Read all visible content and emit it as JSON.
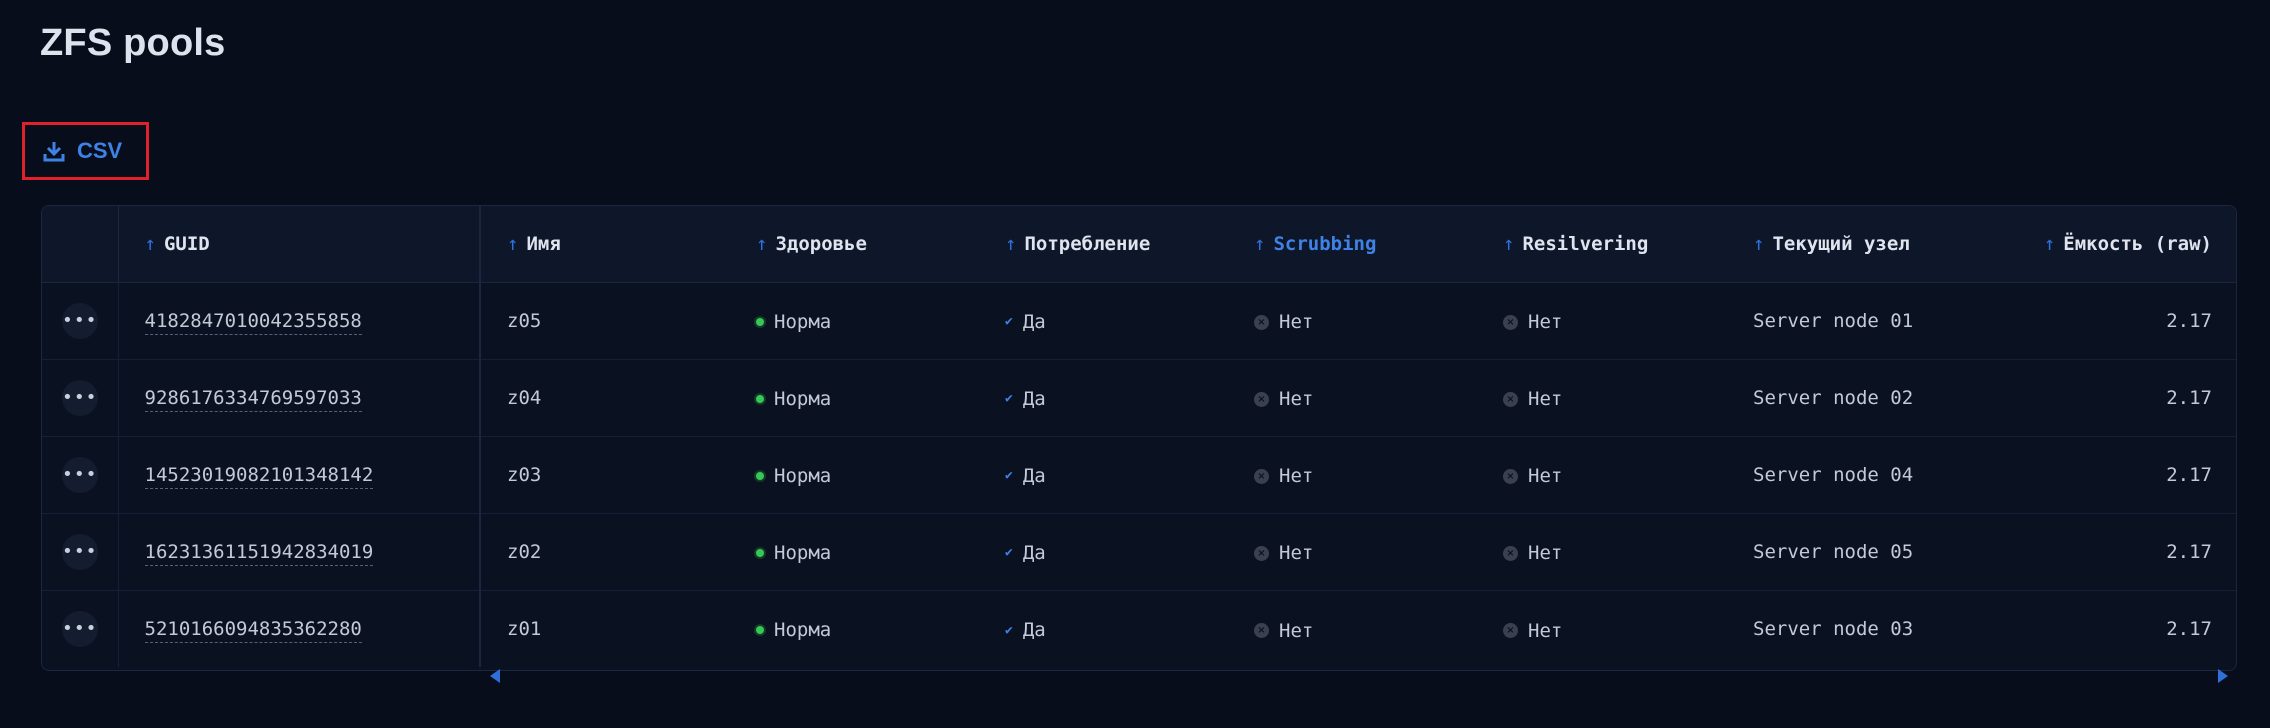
{
  "page": {
    "title": "ZFS pools"
  },
  "toolbar": {
    "csv_label": "CSV",
    "csv_icon": "download-icon",
    "accent": "#3f82e6"
  },
  "table": {
    "columns": [
      {
        "key": "guid",
        "label": "GUID"
      },
      {
        "key": "name",
        "label": "Имя"
      },
      {
        "key": "health",
        "label": "Здоровье"
      },
      {
        "key": "consumption",
        "label": "Потребление"
      },
      {
        "key": "scrubbing",
        "label": "Scrubbing",
        "active": true
      },
      {
        "key": "resilvering",
        "label": "Resilvering"
      },
      {
        "key": "node",
        "label": "Текущий узел"
      },
      {
        "key": "capacity",
        "label": "Ёмкость (raw)"
      }
    ],
    "rows": [
      {
        "guid": "4182847010042355858",
        "name": "z05",
        "health": "Норма",
        "consumption": "Да",
        "scrubbing": "Нет",
        "resilvering": "Нет",
        "node": "Server node 01",
        "capacity": "2.17"
      },
      {
        "guid": "9286176334769597033",
        "name": "z04",
        "health": "Норма",
        "consumption": "Да",
        "scrubbing": "Нет",
        "resilvering": "Нет",
        "node": "Server node 02",
        "capacity": "2.17"
      },
      {
        "guid": "14523019082101348142",
        "name": "z03",
        "health": "Норма",
        "consumption": "Да",
        "scrubbing": "Нет",
        "resilvering": "Нет",
        "node": "Server node 04",
        "capacity": "2.17"
      },
      {
        "guid": "16231361151942834019",
        "name": "z02",
        "health": "Норма",
        "consumption": "Да",
        "scrubbing": "Нет",
        "resilvering": "Нет",
        "node": "Server node 05",
        "capacity": "2.17"
      },
      {
        "guid": "5210166094835362280",
        "name": "z01",
        "health": "Норма",
        "consumption": "Да",
        "scrubbing": "Нет",
        "resilvering": "Нет",
        "node": "Server node 03",
        "capacity": "2.17"
      }
    ],
    "row_menu_icon": "more-horizontal-icon",
    "sort_icon": "arrow-up-icon",
    "status_colors": {
      "ok": "#35c759",
      "yes": "#3f82e6",
      "no": "#3a4050"
    }
  }
}
